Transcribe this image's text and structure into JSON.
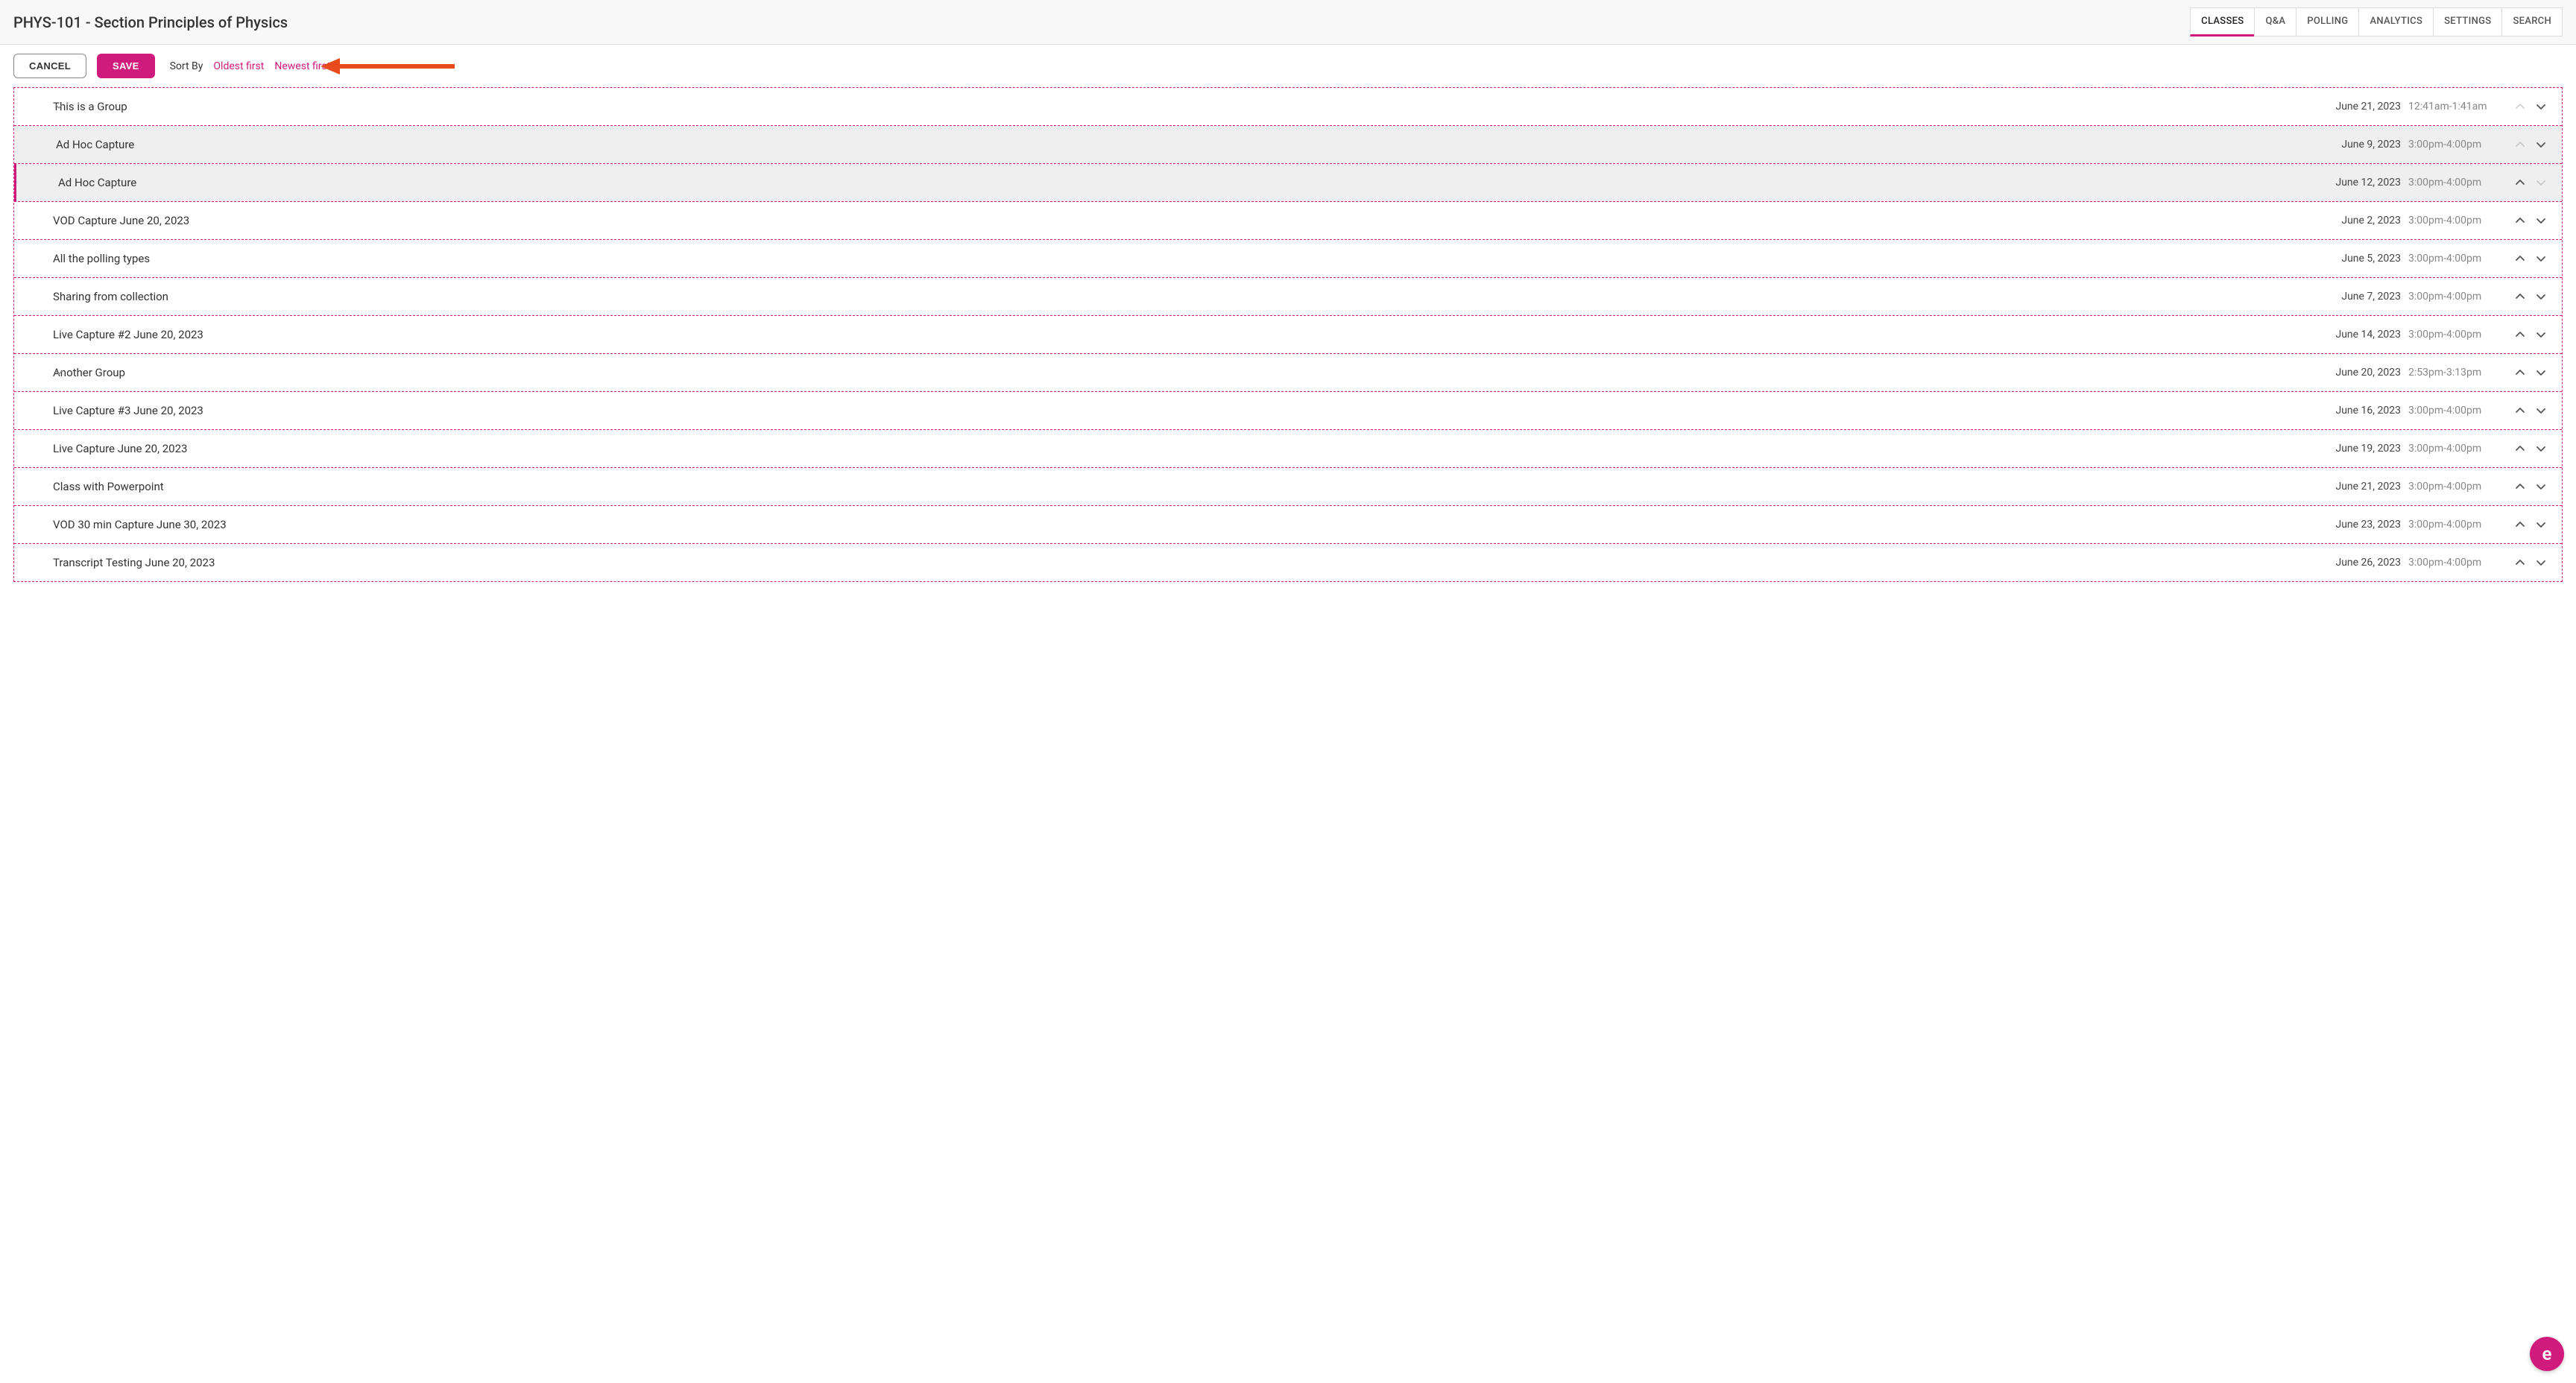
{
  "header": {
    "title": "PHYS-101 - Section Principles of Physics",
    "tabs": [
      {
        "label": "CLASSES",
        "active": true
      },
      {
        "label": "Q&A",
        "active": false
      },
      {
        "label": "POLLING",
        "active": false
      },
      {
        "label": "ANALYTICS",
        "active": false
      },
      {
        "label": "SETTINGS",
        "active": false
      },
      {
        "label": "SEARCH",
        "active": false
      }
    ]
  },
  "toolbar": {
    "cancel_label": "CANCEL",
    "save_label": "SAVE",
    "sort_label": "Sort By",
    "oldest_label": "Oldest first",
    "newest_label": "Newest first"
  },
  "rows": [
    {
      "type": "group",
      "title": "This is a Group",
      "date": "June 21, 2023",
      "time": "12:41am-1:41am",
      "up_disabled": true,
      "down_disabled": false,
      "selected": false
    },
    {
      "type": "child",
      "title": "Ad Hoc Capture",
      "date": "June 9, 2023",
      "time": "3:00pm-4:00pm",
      "up_disabled": true,
      "down_disabled": false,
      "selected": false
    },
    {
      "type": "child",
      "title": "Ad Hoc Capture",
      "date": "June 12, 2023",
      "time": "3:00pm-4:00pm",
      "up_disabled": false,
      "down_disabled": true,
      "selected": true
    },
    {
      "type": "standard",
      "title": "VOD Capture June 20, 2023",
      "date": "June 2, 2023",
      "time": "3:00pm-4:00pm",
      "up_disabled": false,
      "down_disabled": false,
      "selected": false
    },
    {
      "type": "standard",
      "title": "All the polling types",
      "date": "June 5, 2023",
      "time": "3:00pm-4:00pm",
      "up_disabled": false,
      "down_disabled": false,
      "selected": false
    },
    {
      "type": "standard",
      "title": "Sharing from collection",
      "date": "June 7, 2023",
      "time": "3:00pm-4:00pm",
      "up_disabled": false,
      "down_disabled": false,
      "selected": false
    },
    {
      "type": "standard",
      "title": "Live Capture #2 June 20, 2023",
      "date": "June 14, 2023",
      "time": "3:00pm-4:00pm",
      "up_disabled": false,
      "down_disabled": false,
      "selected": false
    },
    {
      "type": "group",
      "title": "Another Group",
      "date": "June 20, 2023",
      "time": "2:53pm-3:13pm",
      "up_disabled": false,
      "down_disabled": false,
      "selected": false
    },
    {
      "type": "standard",
      "title": "Live Capture #3 June 20, 2023",
      "date": "June 16, 2023",
      "time": "3:00pm-4:00pm",
      "up_disabled": false,
      "down_disabled": false,
      "selected": false
    },
    {
      "type": "standard",
      "title": "Live Capture June 20, 2023",
      "date": "June 19, 2023",
      "time": "3:00pm-4:00pm",
      "up_disabled": false,
      "down_disabled": false,
      "selected": false
    },
    {
      "type": "standard",
      "title": "Class with Powerpoint",
      "date": "June 21, 2023",
      "time": "3:00pm-4:00pm",
      "up_disabled": false,
      "down_disabled": false,
      "selected": false
    },
    {
      "type": "standard",
      "title": "VOD 30 min Capture June 30, 2023",
      "date": "June 23, 2023",
      "time": "3:00pm-4:00pm",
      "up_disabled": false,
      "down_disabled": false,
      "selected": false
    },
    {
      "type": "standard",
      "title": "Transcript Testing June 20, 2023",
      "date": "June 26, 2023",
      "time": "3:00pm-4:00pm",
      "up_disabled": false,
      "down_disabled": false,
      "selected": false
    }
  ],
  "fab": {
    "label": "e"
  }
}
